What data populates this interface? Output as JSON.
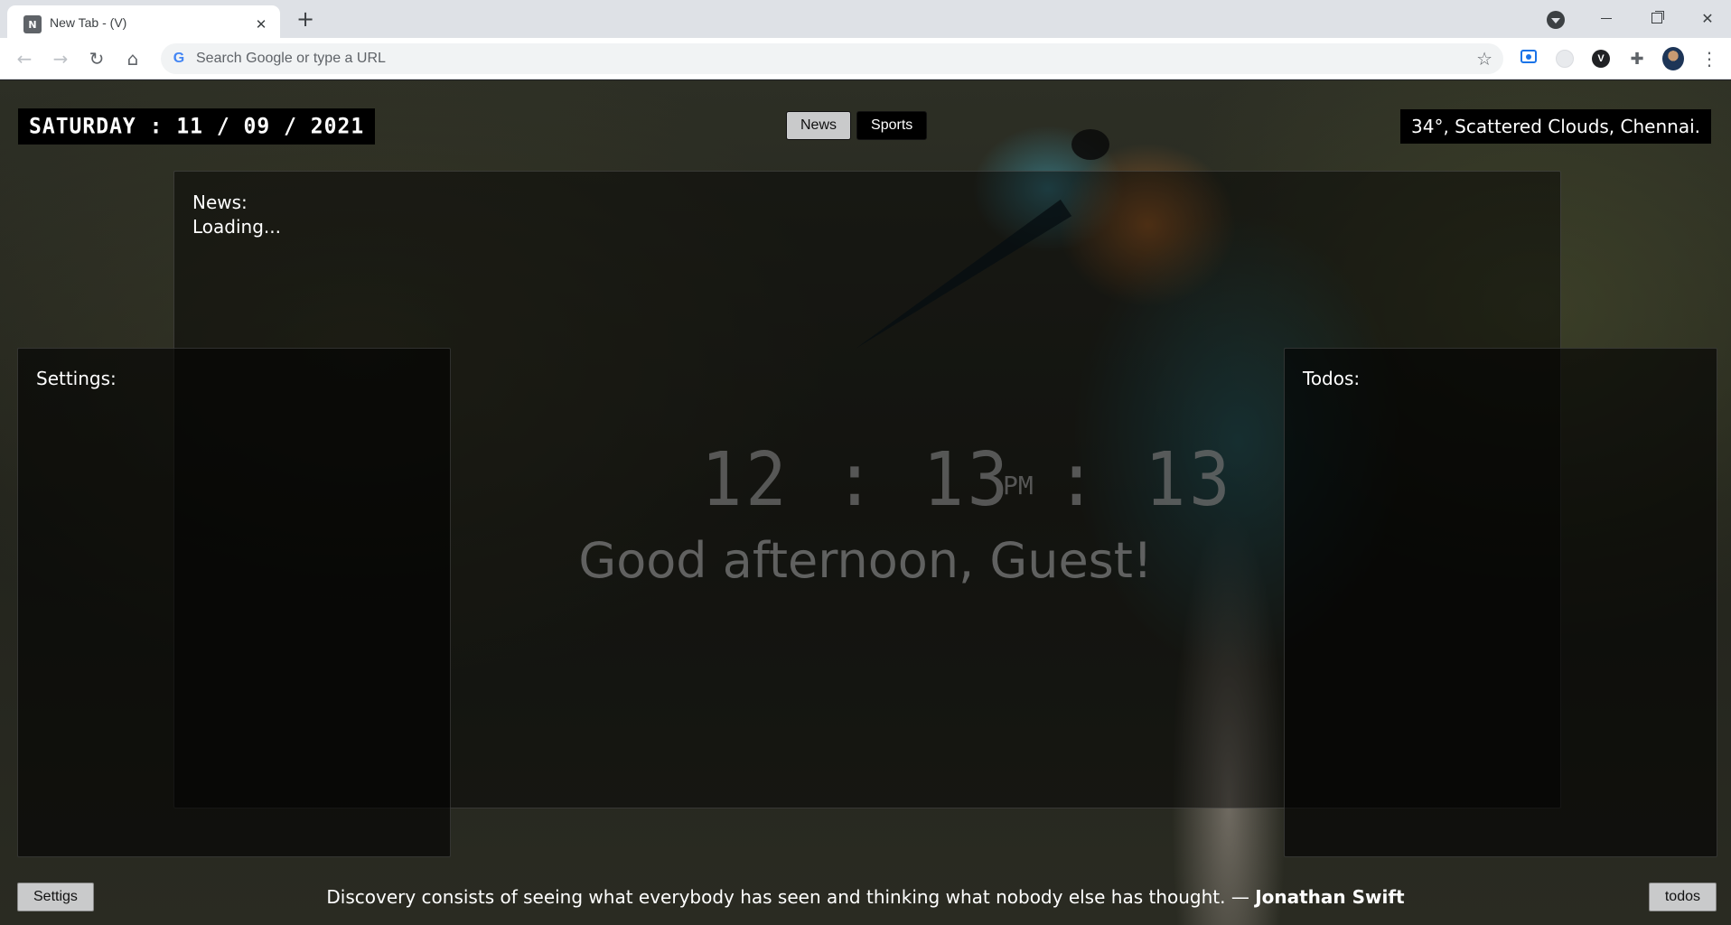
{
  "browser": {
    "tab_title": "New Tab - (V)",
    "tab_favicon_letter": "N",
    "omnibox_placeholder": "Search Google or type a URL",
    "google_letter": "G"
  },
  "header": {
    "date": "SATURDAY : 11 / 09 / 2021",
    "tabs": [
      "News",
      "Sports"
    ],
    "active_tab": "News",
    "weather": "34°, Scattered Clouds, Chennai."
  },
  "news": {
    "title": "News:",
    "status": "Loading..."
  },
  "settings": {
    "title": "Settings:",
    "button_label": "Settigs"
  },
  "todos": {
    "title": "Todos:",
    "button_label": "todos"
  },
  "clock": {
    "time": "12 : 13 : 13",
    "meridiem": "PM"
  },
  "greeting": "Good afternoon, Guest!",
  "quote": {
    "text": "Discovery consists of seeing what everybody has seen and thinking what nobody else has thought. — ",
    "author": "Jonathan Swift"
  },
  "colors": {
    "chrome_bg": "#dee1e6",
    "panel_bg": "#000000",
    "button_bg": "#c9cacb"
  }
}
